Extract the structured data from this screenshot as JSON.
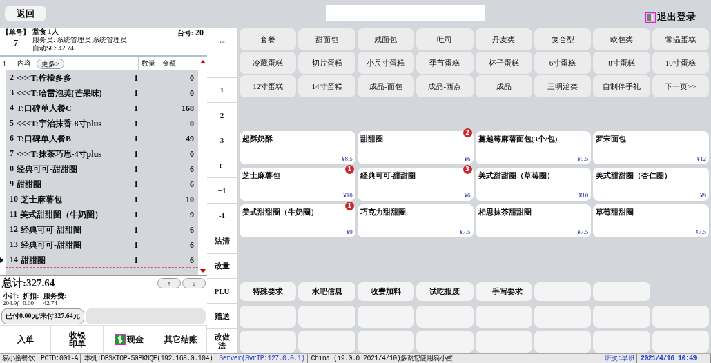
{
  "top_bar": {
    "back_button": "返回",
    "logout": "退出登录"
  },
  "order": {
    "number_label": "【单号】",
    "number": "7",
    "dine_type": "堂食 1人",
    "waiter": "服务员: 系统管理员|系统管理员",
    "auto_sc": "自动SC: 42.74",
    "table_label": "台号:",
    "table_number": "20"
  },
  "table": {
    "columns": [
      "1.",
      "内容",
      "数量",
      "金额"
    ],
    "more_button": "更多>",
    "rows": [
      {
        "no": "2",
        "name": "<<<T:柠檬多多",
        "qty": "1",
        "amount": "0",
        "selected": false
      },
      {
        "no": "3",
        "name": "<<<T:哈雷泡芙(芒果味)",
        "qty": "1",
        "amount": "0",
        "selected": false
      },
      {
        "no": "4",
        "name": "T:口碑单人餐C",
        "qty": "1",
        "amount": "168",
        "selected": false
      },
      {
        "no": "5",
        "name": "<<<T:宇治抹香-8寸plus",
        "qty": "1",
        "amount": "0",
        "selected": false
      },
      {
        "no": "6",
        "name": "T:口碑单人餐B",
        "qty": "1",
        "amount": "49",
        "selected": false
      },
      {
        "no": "7",
        "name": "<<<T:抹茶巧思-4寸plus",
        "qty": "1",
        "amount": "0",
        "selected": false
      },
      {
        "no": "8",
        "name": "经典可可-甜甜圈",
        "qty": "1",
        "amount": "6",
        "selected": false
      },
      {
        "no": "9",
        "name": "甜甜圈",
        "qty": "1",
        "amount": "6",
        "selected": false
      },
      {
        "no": "10",
        "name": "芝士麻薯包",
        "qty": "1",
        "amount": "10",
        "selected": false
      },
      {
        "no": "11",
        "name": "美式甜甜圈（牛奶圈）",
        "qty": "1",
        "amount": "9",
        "selected": false
      },
      {
        "no": "12",
        "name": "经典可可-甜甜圈",
        "qty": "1",
        "amount": "6",
        "selected": false
      },
      {
        "no": "13",
        "name": "经典可可-甜甜圈",
        "qty": "1",
        "amount": "6",
        "selected": false
      },
      {
        "no": "14",
        "name": "甜甜圈",
        "qty": "1",
        "amount": "6",
        "selected": true
      }
    ]
  },
  "totals": {
    "total": "总计:327.64",
    "up_button": "↑",
    "down_button": "↓",
    "breakdown": [
      {
        "label": "小计:",
        "value": "204.9("
      },
      {
        "label": "折扣:",
        "value": "0.00"
      },
      {
        "label": "服务费:",
        "value": "42.74"
      }
    ],
    "paid": "已付0.00元/未付327.64元"
  },
  "actions": [
    {
      "label": "入单",
      "kind": "plain"
    },
    {
      "label": "收银印单",
      "kind": "stacked"
    },
    {
      "label": "现金",
      "kind": "cash"
    },
    {
      "label": "其它结账",
      "kind": "plain"
    }
  ],
  "keypad": [
    {
      "label": "...",
      "kind": "key"
    },
    {
      "kind": "blank"
    },
    {
      "label": "1",
      "kind": "key"
    },
    {
      "label": "2",
      "kind": "key"
    },
    {
      "label": "3",
      "kind": "key"
    },
    {
      "label": "C",
      "kind": "key"
    },
    {
      "label": "+1",
      "kind": "key"
    },
    {
      "label": "-1",
      "kind": "key"
    },
    {
      "label": "沽清",
      "kind": "key"
    },
    {
      "label": "改量",
      "kind": "key"
    },
    {
      "label": "PLU",
      "kind": "key"
    },
    {
      "label": "赠送",
      "kind": "key"
    },
    {
      "label": "改做法",
      "kind": "key"
    }
  ],
  "categories": [
    "套餐",
    "甜面包",
    "咸面包",
    "吐司",
    "丹麦类",
    "复合型",
    "欧包类",
    "常温蛋糕",
    "冷藏蛋糕",
    "切片蛋糕",
    "小尺寸蛋糕",
    "季节蛋糕",
    "杯子蛋糕",
    "6寸蛋糕",
    "8寸蛋糕",
    "10寸蛋糕",
    "12寸蛋糕",
    "14寸蛋糕",
    "成品-面包",
    "成品-西点",
    "成品",
    "三明治类",
    "自制伴手礼",
    "下一页>>"
  ],
  "products": [
    {
      "name": "起酥奶酥",
      "price": "¥8.5"
    },
    {
      "name": "甜甜圈",
      "price": "¥6",
      "badge": "2"
    },
    {
      "name": "蔓越莓麻薯面包(3个/包)",
      "price": "¥9.5"
    },
    {
      "name": "罗宋面包",
      "price": "¥12"
    },
    {
      "name": "芝士麻薯包",
      "price": "¥10",
      "badge": "1"
    },
    {
      "name": "经典可可-甜甜圈",
      "price": "¥6",
      "badge": "3"
    },
    {
      "name": "美式甜甜圈（草莓圈）",
      "price": "¥10"
    },
    {
      "name": "美式甜甜圈（杏仁圈）",
      "price": "¥9"
    },
    {
      "name": "美式甜甜圈（牛奶圈）",
      "price": "¥9",
      "badge": "1"
    },
    {
      "name": "巧克力甜甜圈",
      "price": "¥7.5"
    },
    {
      "name": "相思抹茶甜甜圈",
      "price": "¥7.5"
    },
    {
      "name": "草莓甜甜圈",
      "price": "¥7.5"
    }
  ],
  "modifier_rows": [
    [
      {
        "label": "特殊要求",
        "kind": "button"
      },
      {
        "label": "水吧信息",
        "kind": "button"
      },
      {
        "label": "收费加料",
        "kind": "button"
      },
      {
        "label": "试吃报废",
        "kind": "button"
      },
      {
        "label": "__手写要求",
        "kind": "button"
      },
      {
        "kind": "blank"
      },
      {
        "kind": "blank"
      },
      {
        "kind": "none"
      }
    ],
    [
      {
        "kind": "blank"
      },
      {
        "kind": "blank"
      },
      {
        "kind": "blank"
      },
      {
        "kind": "blank"
      },
      {
        "kind": "blank"
      },
      {
        "kind": "blank"
      },
      {
        "kind": "blank"
      },
      {
        "kind": "blank"
      }
    ],
    [
      {
        "kind": "blank"
      },
      {
        "kind": "blank"
      },
      {
        "kind": "blank"
      },
      {
        "kind": "blank"
      },
      {
        "kind": "blank"
      },
      {
        "kind": "blank"
      },
      {
        "kind": "blank"
      },
      {
        "kind": "blank"
      }
    ]
  ],
  "status_bar": [
    {
      "text": "易小蜜餐饮",
      "kind": "plain"
    },
    {
      "text": "PCID:001-A",
      "kind": "plain"
    },
    {
      "text": "本机:DESKTOP-50PKNQE(192.168.0.104)",
      "kind": "plain"
    },
    {
      "text": "Server(SvrIP:127.0.0.1)",
      "kind": "link"
    },
    {
      "text": "China (i9.0.0 2021/4/10)多谢您使用易小蜜",
      "kind": "grow"
    },
    {
      "text": "班次:早班",
      "kind": "link"
    },
    {
      "text": "2021/4/16 10:49",
      "kind": "time"
    }
  ]
}
